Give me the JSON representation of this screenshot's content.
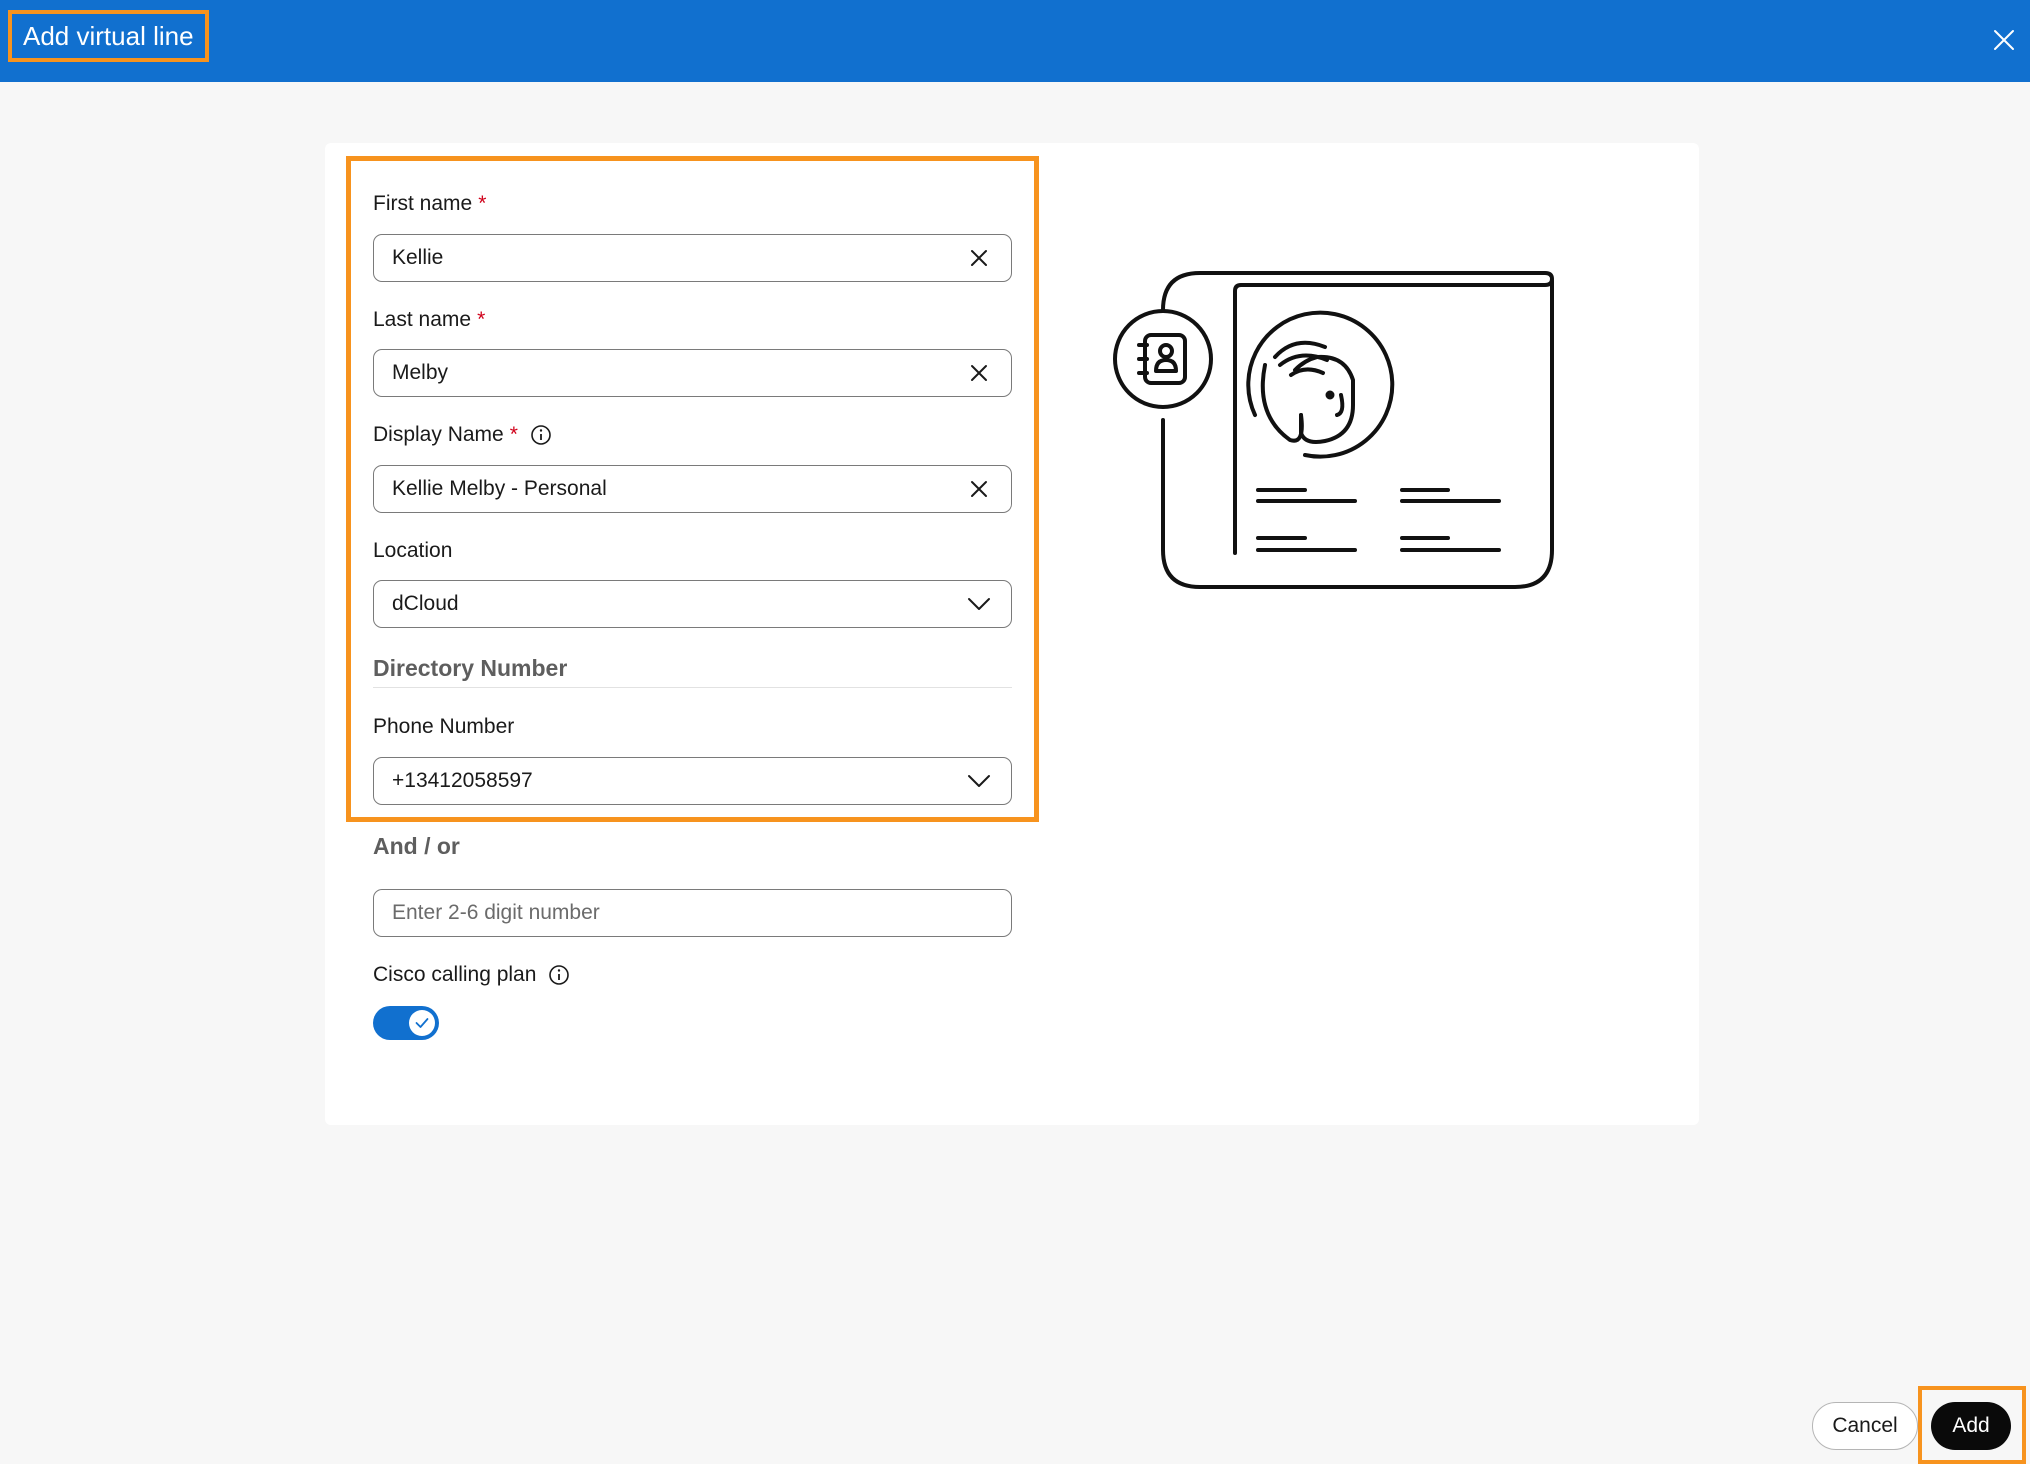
{
  "header": {
    "title": "Add virtual line"
  },
  "colors": {
    "header_bg": "#1170cf",
    "highlight": "#f7931e",
    "required": "#d0021b",
    "toggle_on": "#1170cf",
    "primary_button": "#0a0a0a"
  },
  "form": {
    "first_name": {
      "label": "First name",
      "required": "*",
      "value": "Kellie"
    },
    "last_name": {
      "label": "Last name",
      "required": "*",
      "value": "Melby"
    },
    "display_name": {
      "label": "Display Name",
      "required": "*",
      "value": "Kellie Melby - Personal"
    },
    "location": {
      "label": "Location",
      "value": "dCloud"
    },
    "directory_section": "Directory Number",
    "phone_number": {
      "label": "Phone Number",
      "value": "+13412058597"
    },
    "and_or": "And / or",
    "extension": {
      "placeholder": "Enter 2-6 digit number"
    },
    "calling_plan": {
      "label": "Cisco calling plan",
      "enabled": true
    }
  },
  "footer": {
    "cancel_label": "Cancel",
    "add_label": "Add"
  },
  "icons": [
    "close-icon",
    "clear-icon",
    "info-icon",
    "chevron-down-icon",
    "check-icon",
    "contact-card-illustration"
  ]
}
